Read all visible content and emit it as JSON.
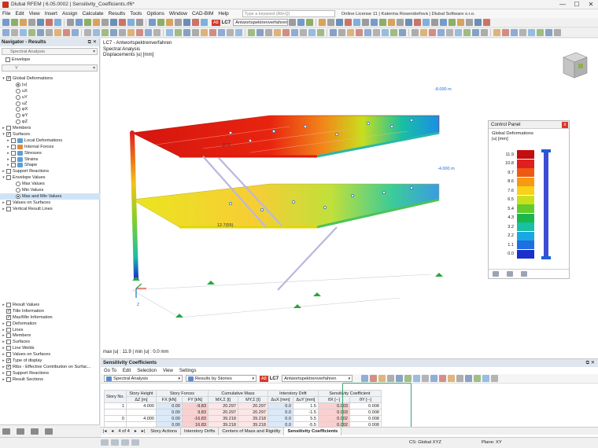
{
  "app": {
    "title": "Dlubal RFEM | 6.05.0002 | Sensitivity_Coefficients.rf6*",
    "controls": [
      "—",
      "☐",
      "✕"
    ]
  },
  "menu": {
    "items": [
      "File",
      "Edit",
      "View",
      "Insert",
      "Assign",
      "Calculate",
      "Results",
      "Tools",
      "Options",
      "Window",
      "CAD-BIM",
      "Help"
    ],
    "search_placeholder": "Type a keyword (Alt+Q)",
    "license": "Online License 11 | Katerina Rosendorfová | Dlubal Software s.r.o."
  },
  "toolbar": {
    "lc_badge": "A8",
    "lc_label": "LC7",
    "lc_name": "Antwortspektrenverfahren"
  },
  "navigator": {
    "title": "Navigator - Results",
    "controls": "⧉ ✕",
    "analysis": "Spectral Analysis",
    "envelope_label": "Envelope",
    "direction": "Y",
    "tree": [
      {
        "label": "Global Deformations",
        "indent": 0,
        "exp": "▾",
        "kind": "chk",
        "on": true
      },
      {
        "label": "|u|",
        "indent": 2,
        "kind": "rad",
        "on": true
      },
      {
        "label": "uX",
        "indent": 2,
        "kind": "rad"
      },
      {
        "label": "uY",
        "indent": 2,
        "kind": "rad"
      },
      {
        "label": "uZ",
        "indent": 2,
        "kind": "rad"
      },
      {
        "label": "φX",
        "indent": 2,
        "kind": "rad"
      },
      {
        "label": "φY",
        "indent": 2,
        "kind": "rad"
      },
      {
        "label": "φZ",
        "indent": 2,
        "kind": "rad"
      },
      {
        "label": "Members",
        "indent": 0,
        "exp": "▸",
        "kind": "chk"
      },
      {
        "label": "Surfaces",
        "indent": 0,
        "exp": "▾",
        "kind": "chk",
        "on": true
      },
      {
        "label": "Local Deformations",
        "indent": 1,
        "exp": "▸",
        "kind": "chk",
        "icon": "#5aa0d8"
      },
      {
        "label": "Internal Forces",
        "indent": 1,
        "exp": "▸",
        "kind": "chk",
        "icon": "#e08a3a"
      },
      {
        "label": "Stresses",
        "indent": 1,
        "exp": "▸",
        "kind": "chk",
        "icon": "#5aa0d8"
      },
      {
        "label": "Strains",
        "indent": 1,
        "exp": "▸",
        "kind": "chk",
        "icon": "#5aa0d8"
      },
      {
        "label": "Shape",
        "indent": 1,
        "exp": "▸",
        "kind": "chk",
        "icon": "#5aa0d8"
      },
      {
        "label": "Support Reactions",
        "indent": 0,
        "exp": "▸",
        "kind": "chk"
      },
      {
        "label": "Envelope Values",
        "indent": 0,
        "exp": "▾",
        "kind": "chk"
      },
      {
        "label": "Max Values",
        "indent": 2,
        "kind": "rad"
      },
      {
        "label": "Min Values",
        "indent": 2,
        "kind": "rad"
      },
      {
        "label": "Max and Min Values",
        "indent": 2,
        "kind": "rad",
        "on": true,
        "sel": true
      },
      {
        "label": "Values on Surfaces",
        "indent": 0,
        "exp": "▸",
        "kind": "chk"
      },
      {
        "label": "Vertical Result Lines",
        "indent": 0,
        "exp": "▸",
        "kind": "chk"
      }
    ],
    "tree2": [
      {
        "label": "Result Values",
        "exp": "▸",
        "on": false
      },
      {
        "label": "Title Information",
        "exp": "",
        "on": true
      },
      {
        "label": "Max/Min Information",
        "exp": "",
        "on": true
      },
      {
        "label": "Deformation",
        "exp": "▸",
        "on": false
      },
      {
        "label": "Lines",
        "exp": "▸",
        "on": false
      },
      {
        "label": "Members",
        "exp": "▸",
        "on": false
      },
      {
        "label": "Surfaces",
        "exp": "▸",
        "on": false
      },
      {
        "label": "Line Welds",
        "exp": "▸",
        "on": false
      },
      {
        "label": "Values on Surfaces",
        "exp": "▸",
        "on": false
      },
      {
        "label": "Type of display",
        "exp": "▸",
        "on": true
      },
      {
        "label": "Ribs - Effective Contribution on Surfac...",
        "exp": "▸",
        "on": true
      },
      {
        "label": "Support Reactions",
        "exp": "▸",
        "on": false
      },
      {
        "label": "Result Sections",
        "exp": "▸",
        "on": false
      }
    ]
  },
  "view": {
    "info": [
      "LC7 - Antwortspektrenverfahren",
      "Spectral Analysis",
      "Displacements |u| [mm]"
    ],
    "maxmin": "max |u| : 11.9 | min |u| : 0.0 mm",
    "labels": {
      "top_right": "-8.000 m",
      "mid_right": "-4.000 m",
      "node_a": "12.6",
      "node_b": "12.7(55)"
    }
  },
  "control_panel": {
    "title": "Control Panel",
    "close": "x",
    "heading": "Global Deformations",
    "unit": "|u| [mm]",
    "legend": [
      {
        "value": "11.9",
        "color": "#c40d0d"
      },
      {
        "value": "10.8",
        "color": "#e02020"
      },
      {
        "value": "9.7",
        "color": "#ee5a12"
      },
      {
        "value": "8.6",
        "color": "#f69a14"
      },
      {
        "value": "7.6",
        "color": "#f9d01a"
      },
      {
        "value": "6.5",
        "color": "#c9e01c"
      },
      {
        "value": "5.4",
        "color": "#62cc2d"
      },
      {
        "value": "4.3",
        "color": "#19b84a"
      },
      {
        "value": "3.2",
        "color": "#19c0a4"
      },
      {
        "value": "2.2",
        "color": "#19a8e3"
      },
      {
        "value": "1.1",
        "color": "#1d6fe2"
      },
      {
        "value": "0.0",
        "color": "#1a2fcc"
      }
    ]
  },
  "results": {
    "title": "Sensitivity Coefficients",
    "controls": "⧉ ✕",
    "menu": [
      "Go To",
      "Edit",
      "Selection",
      "View",
      "Settings"
    ],
    "analysis": "Spectral Analysis",
    "by": "Results by Stories",
    "lc_badge": "A8",
    "lc_label": "LC7",
    "lc_name": "Antwortspektrenverfahren",
    "head1": [
      "Story No.",
      "Story Height",
      "Story Forces",
      "Cumulative Mass",
      "Interstory Drift",
      "Sensitivity Coefficient"
    ],
    "head2": [
      "ΔZ [m]",
      "FX [kN]",
      "FY [kN]",
      "MX,Σ [t]",
      "MY,Σ [t]",
      "ΔuX [mm]",
      "ΔuY [mm]",
      "θX [--]",
      "θY [--]"
    ],
    "rows": [
      {
        "story": "1",
        "dz": "4.000",
        "fx": "0.00",
        "fy": "-9.83",
        "mx": "20.297",
        "my": "20.297",
        "dux": "0.0",
        "duy": "1.5",
        "tx": "0.003",
        "ty": "0.008"
      },
      {
        "story": "",
        "dz": "",
        "fx": "0.00",
        "fy": "9.83",
        "mx": "20.297",
        "my": "20.297",
        "dux": "0.0",
        "duy": "-1.5",
        "tx": "0.003",
        "ty": "0.008"
      },
      {
        "story": "0",
        "dz": "4.000",
        "fx": "0.00",
        "fy": "-16.83",
        "mx": "39.218",
        "my": "39.218",
        "dux": "0.0",
        "duy": "5.5",
        "tx": "0.002",
        "ty": "0.008"
      },
      {
        "story": "",
        "dz": "",
        "fx": "0.00",
        "fy": "16.83",
        "mx": "39.218",
        "my": "39.218",
        "dux": "0.0",
        "duy": "-5.5",
        "tx": "0.002",
        "ty": "0.008"
      }
    ],
    "page": "4 of 4",
    "tabs": [
      "Story Actions",
      "Interstory Drifts",
      "Centers of Mass and Rigidity",
      "Sensitivity Coefficients"
    ]
  },
  "status": {
    "cs": "CS: Global XYZ",
    "plane": "Plane: XY"
  }
}
